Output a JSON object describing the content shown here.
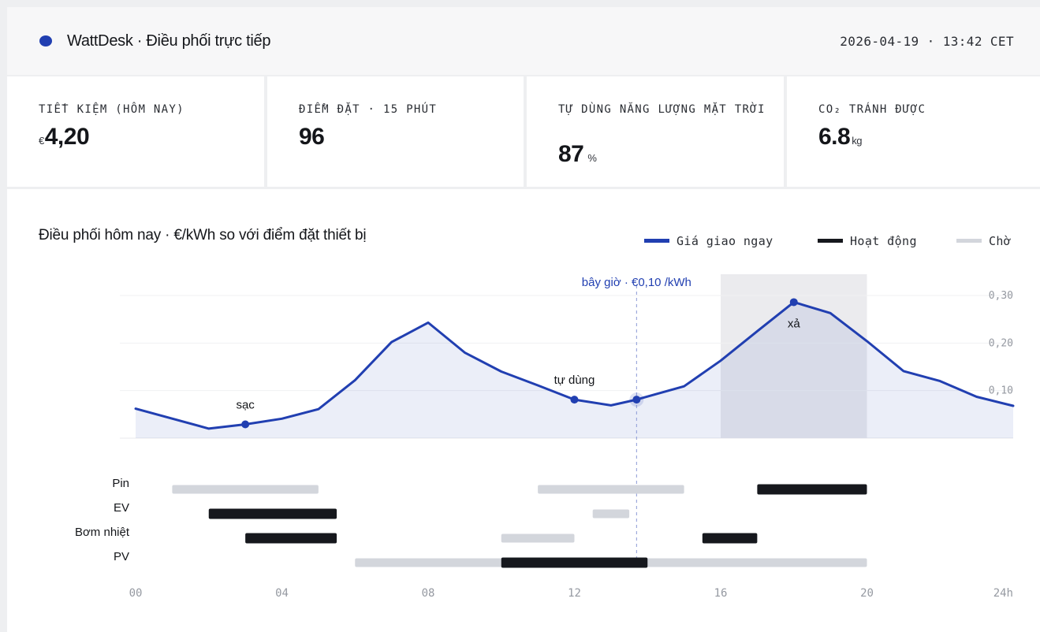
{
  "header": {
    "title": "WattDesk · Điều phối trực tiếp",
    "datetime": "2026-04-19 · 13:42 CET",
    "brand_color": "#213fb1"
  },
  "kpis": [
    {
      "label": "TIẾT KIỆM (HÔM NAY)",
      "prefix": "€",
      "value": "4,20",
      "unit": ""
    },
    {
      "label": "ĐIỂM ĐẶT · 15 PHÚT",
      "prefix": "",
      "value": "96",
      "unit": ""
    },
    {
      "label": "TỰ DÙNG NĂNG LƯỢNG MẶT TRỜI",
      "prefix": "",
      "value": "87",
      "unit": "%"
    },
    {
      "label": "CO₂ TRÁNH ĐƯỢC",
      "prefix": "",
      "value": "6.8",
      "unit": "kg"
    }
  ],
  "chart": {
    "title": "Điều phối hôm nay · €/kWh so với điểm đặt thiết bị",
    "legend": [
      {
        "label": "Giá giao ngay",
        "color": "#213fb1",
        "icon": "line-swatch"
      },
      {
        "label": "Hoạt động",
        "color": "#16181d",
        "icon": "bar-swatch"
      },
      {
        "label": "Chờ",
        "color": "#d3d6dc",
        "icon": "bar-swatch"
      }
    ],
    "now_label": "bây giờ · €0,10 /kWh"
  },
  "chart_data": {
    "type": "line",
    "title": "Điều phối hôm nay · €/kWh so với điểm đặt thiết bị",
    "xlabel": "",
    "ylabel": "",
    "xlim": [
      0,
      24
    ],
    "ylim": [
      0,
      0.3
    ],
    "x_ticks": [
      "00",
      "04",
      "08",
      "12",
      "16",
      "20",
      "24h"
    ],
    "y_ticks": [
      "0,10",
      "0,20",
      "0,30"
    ],
    "grid": true,
    "legend_position": "top-right",
    "series": [
      {
        "name": "Giá giao ngay",
        "color": "#213fb1",
        "points": [
          [
            0,
            0.062
          ],
          [
            2,
            0.02
          ],
          [
            3,
            0.029
          ],
          [
            4,
            0.041
          ],
          [
            5,
            0.061
          ],
          [
            6,
            0.122
          ],
          [
            7,
            0.202
          ],
          [
            8,
            0.243
          ],
          [
            9,
            0.18
          ],
          [
            10,
            0.14
          ],
          [
            11,
            0.111
          ],
          [
            12,
            0.081
          ],
          [
            13,
            0.069
          ],
          [
            13.7,
            0.081
          ],
          [
            15,
            0.109
          ],
          [
            16,
            0.163
          ],
          [
            17,
            0.225
          ],
          [
            18,
            0.286
          ],
          [
            19,
            0.263
          ],
          [
            20,
            0.204
          ],
          [
            21,
            0.141
          ],
          [
            22,
            0.12
          ],
          [
            23,
            0.087
          ],
          [
            24,
            0.068
          ]
        ]
      }
    ],
    "annotations": [
      {
        "label": "sạc",
        "x": 3,
        "y": 0.029
      },
      {
        "label": "tự dùng",
        "x": 12,
        "y": 0.081
      },
      {
        "label": "xả",
        "x": 18,
        "y": 0.286
      }
    ],
    "now_marker": {
      "x": 13.7,
      "y": 0.081,
      "label": "bây giờ · €0,10 /kWh"
    },
    "shaded_region": [
      16,
      20
    ],
    "devices": [
      {
        "name": "Pin",
        "intervals": [
          {
            "start": 1,
            "end": 5,
            "state": "Chờ"
          },
          {
            "start": 11,
            "end": 15,
            "state": "Chờ"
          },
          {
            "start": 17,
            "end": 20,
            "state": "Hoạt động"
          }
        ]
      },
      {
        "name": "EV",
        "intervals": [
          {
            "start": 2,
            "end": 5.5,
            "state": "Hoạt động"
          },
          {
            "start": 12.5,
            "end": 13.5,
            "state": "Chờ"
          }
        ]
      },
      {
        "name": "Bơm nhiệt",
        "intervals": [
          {
            "start": 3,
            "end": 5.5,
            "state": "Hoạt động"
          },
          {
            "start": 10,
            "end": 12,
            "state": "Chờ"
          },
          {
            "start": 15.5,
            "end": 17,
            "state": "Hoạt động"
          }
        ]
      },
      {
        "name": "PV",
        "intervals": [
          {
            "start": 6,
            "end": 20,
            "state": "Chờ"
          },
          {
            "start": 10,
            "end": 14,
            "state": "Hoạt động"
          }
        ]
      }
    ]
  }
}
